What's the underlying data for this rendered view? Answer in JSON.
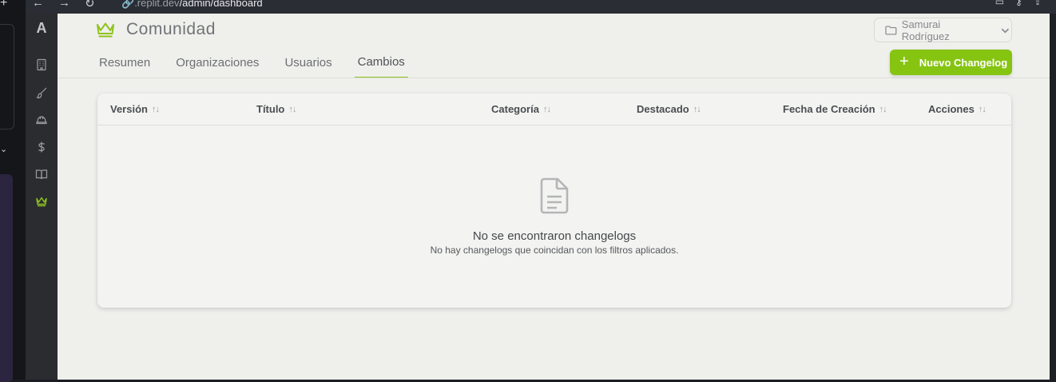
{
  "browser": {
    "url_host": ".replit.dev",
    "url_path": "/admin/dashboard"
  },
  "sidebar": {
    "logo": "A",
    "items": [
      {
        "icon": "building-icon",
        "active": false
      },
      {
        "icon": "brush-icon",
        "active": false
      },
      {
        "icon": "hard-hat-icon",
        "active": false
      },
      {
        "icon": "dollar-icon",
        "active": false
      },
      {
        "icon": "book-icon",
        "active": false
      },
      {
        "icon": "crown-icon",
        "active": true
      }
    ]
  },
  "header": {
    "title": "Comunidad",
    "title_icon": "crown-icon",
    "user_select": "Samurai Rodríguez",
    "new_button": "Nuevo Changelog"
  },
  "tabs": [
    {
      "label": "Resumen",
      "active": false
    },
    {
      "label": "Organizaciones",
      "active": false
    },
    {
      "label": "Usuarios",
      "active": false
    },
    {
      "label": "Cambios",
      "active": true
    }
  ],
  "table": {
    "columns": [
      "Versión",
      "Título",
      "Categoría",
      "Destacado",
      "Fecha de Creación",
      "Acciones"
    ],
    "rows": [],
    "empty_title": "No se encontraron changelogs",
    "empty_subtitle": "No hay changelogs que coincidan con los filtros aplicados."
  },
  "colors": {
    "accent": "#86c412",
    "crown": "#8fc31f",
    "sidebar_bg": "#2b2c30",
    "main_bg": "#efefec"
  }
}
